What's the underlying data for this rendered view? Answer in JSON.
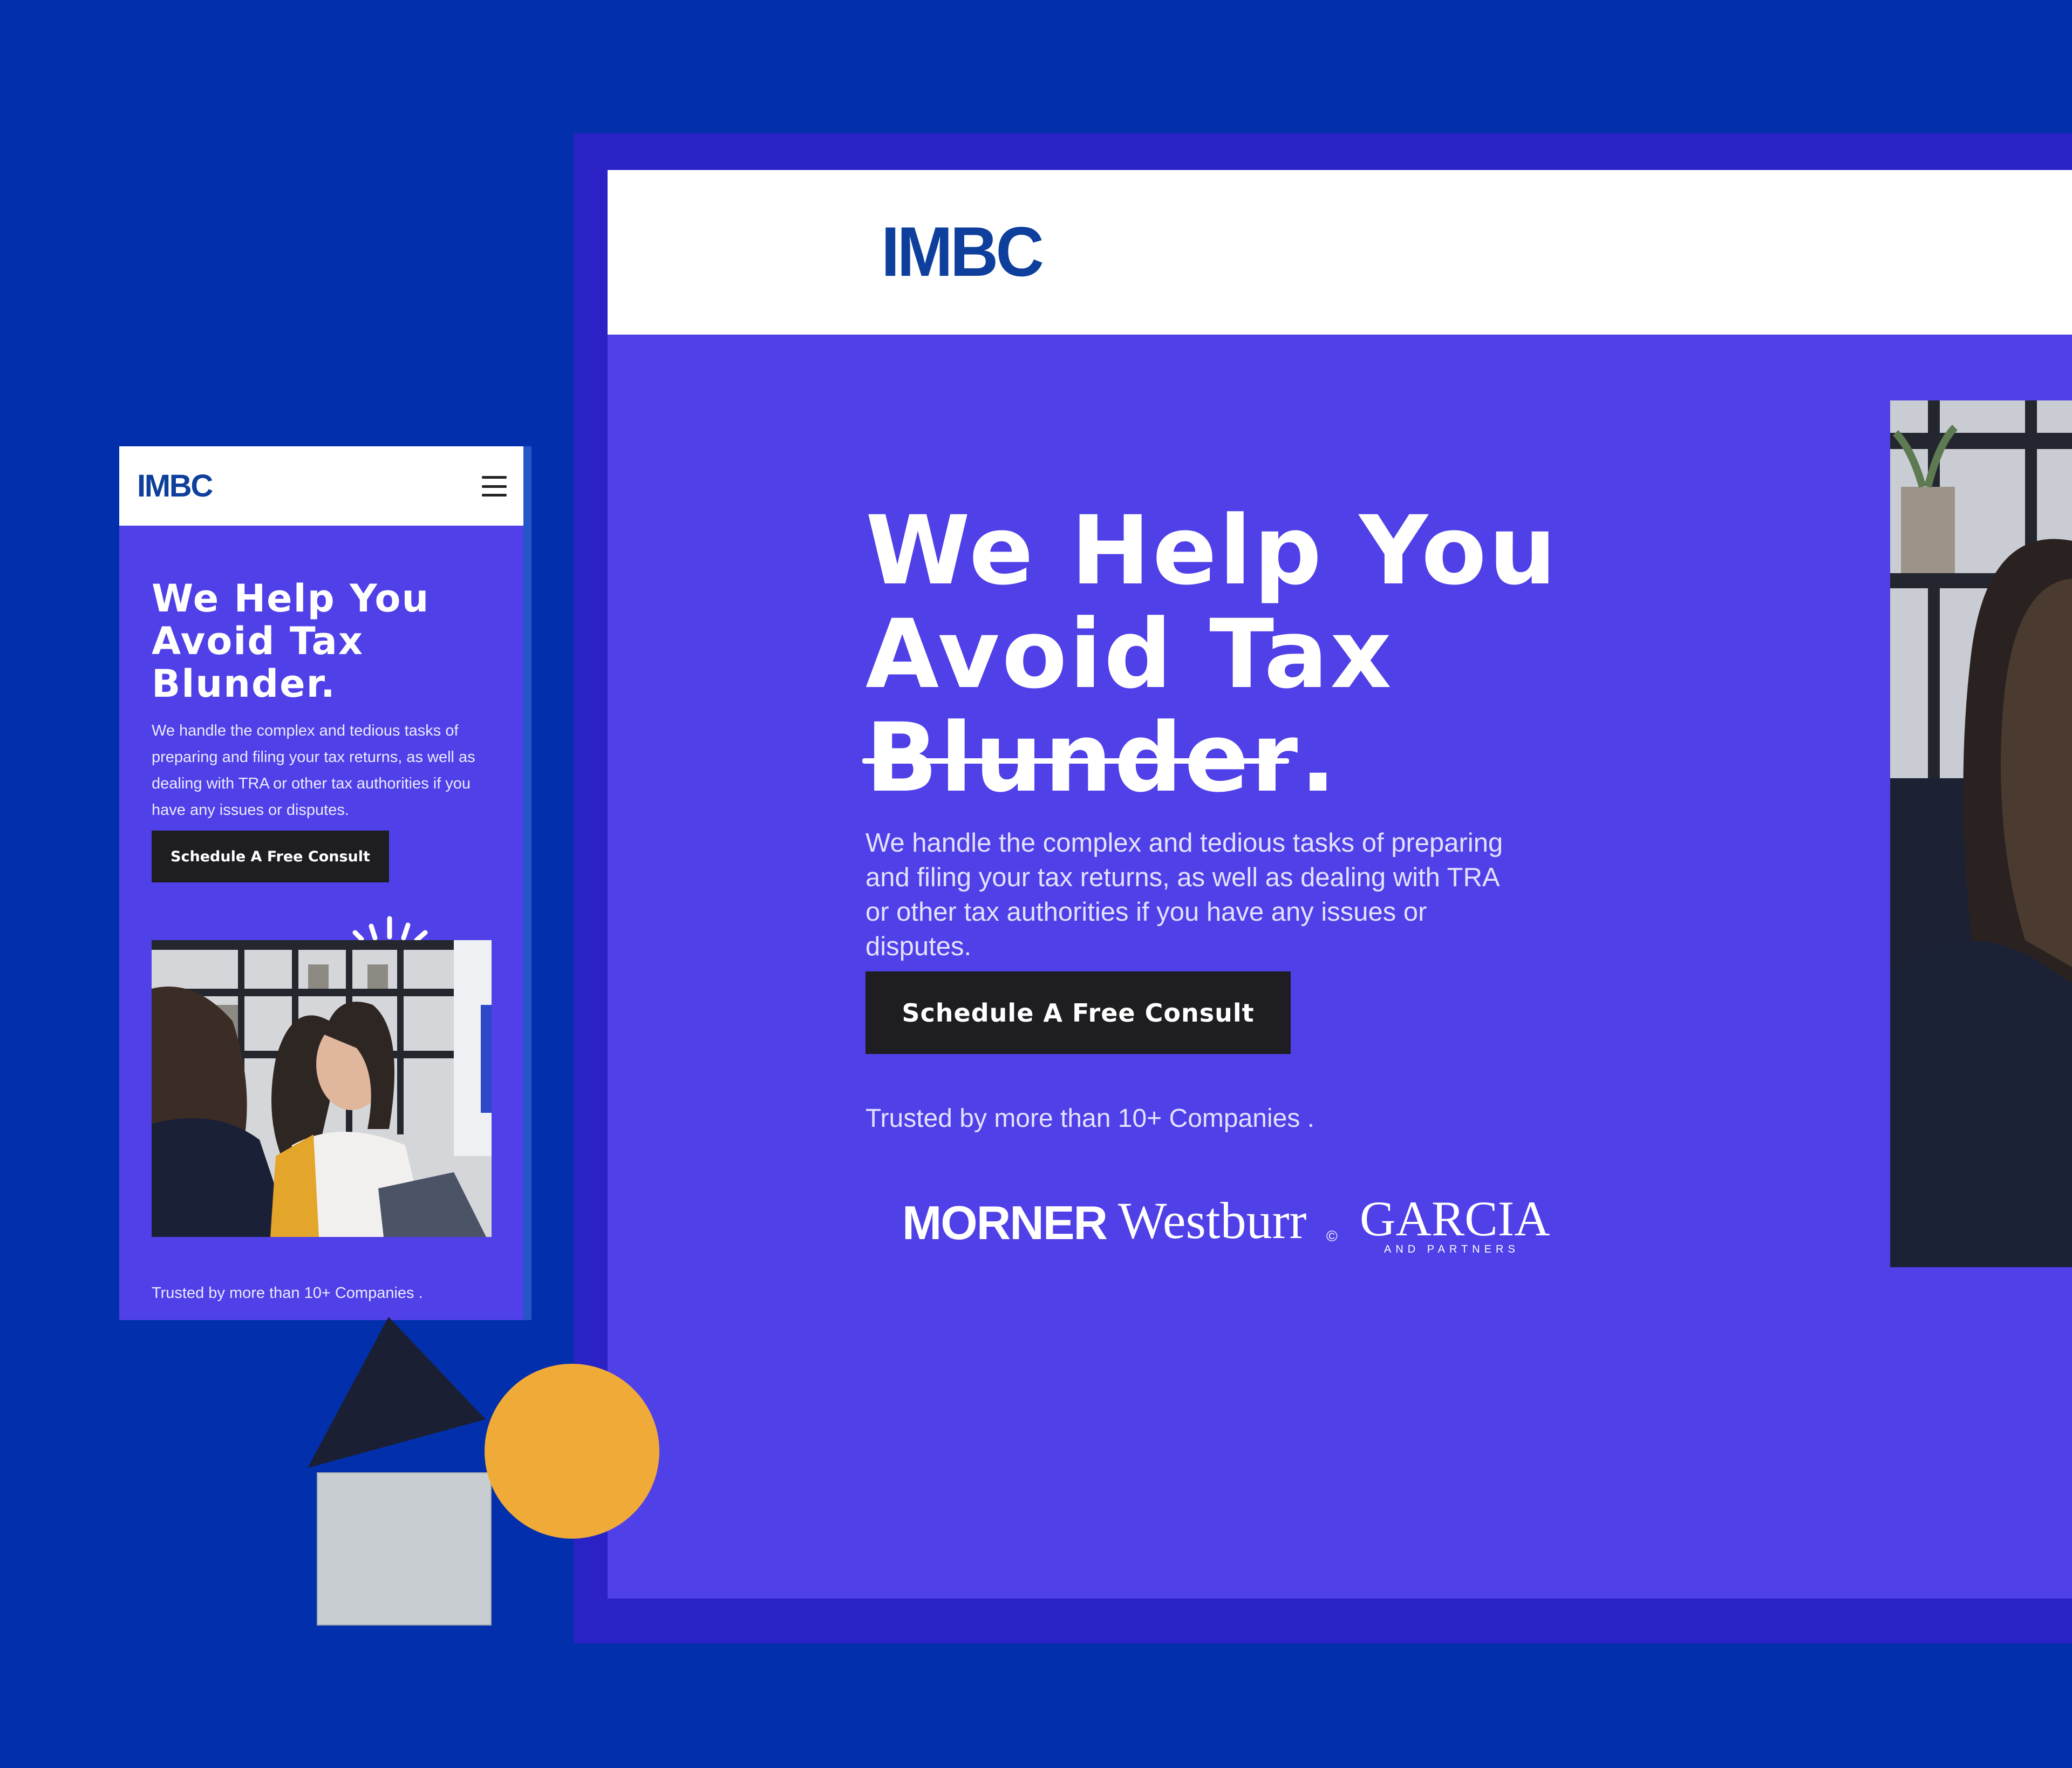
{
  "colors": {
    "background": "#0230ad",
    "frame": "#2a22c5",
    "hero": "#5040e8",
    "logo": "#0f3f9c",
    "cta": "#1e1e22",
    "circle": "#f0aa37",
    "square": "#c8cdd2",
    "triangle": "#1b1f33"
  },
  "desktop": {
    "header": {
      "logo": "IMBC"
    },
    "hero": {
      "title_line1": "We Help You",
      "title_line2": "Avoid Tax",
      "title_line3": "Blunder.",
      "title_line3_word": "Blunder",
      "title_line3_punct": ".",
      "subtitle": "We handle the complex and tedious tasks of preparing and filing your tax returns, as well as dealing with TRA or other tax authorities if you have any issues or disputes.",
      "cta_label": "Schedule A Free Consult",
      "trusted_text": "Trusted by more than 10+ Companies .",
      "partner_logos": {
        "morner": "MORNER",
        "westburr": "Westburr",
        "westburr_mark": "©",
        "garcia": "GARCIA",
        "garcia_sub": "AND PARTNERS"
      }
    }
  },
  "mobile": {
    "header": {
      "logo": "IMBC",
      "menu_icon": "hamburger-icon"
    },
    "hero": {
      "title_line1": "We Help You",
      "title_line2": "Avoid Tax",
      "title_line3": "Blunder.",
      "subtitle": "We handle the complex and tedious tasks of preparing and filing your tax returns, as well as dealing with TRA or other tax authorities if you have any issues or disputes.",
      "cta_label": "Schedule A Free Consult",
      "trusted_text": "Trusted by more than 10+ Companies ."
    }
  }
}
